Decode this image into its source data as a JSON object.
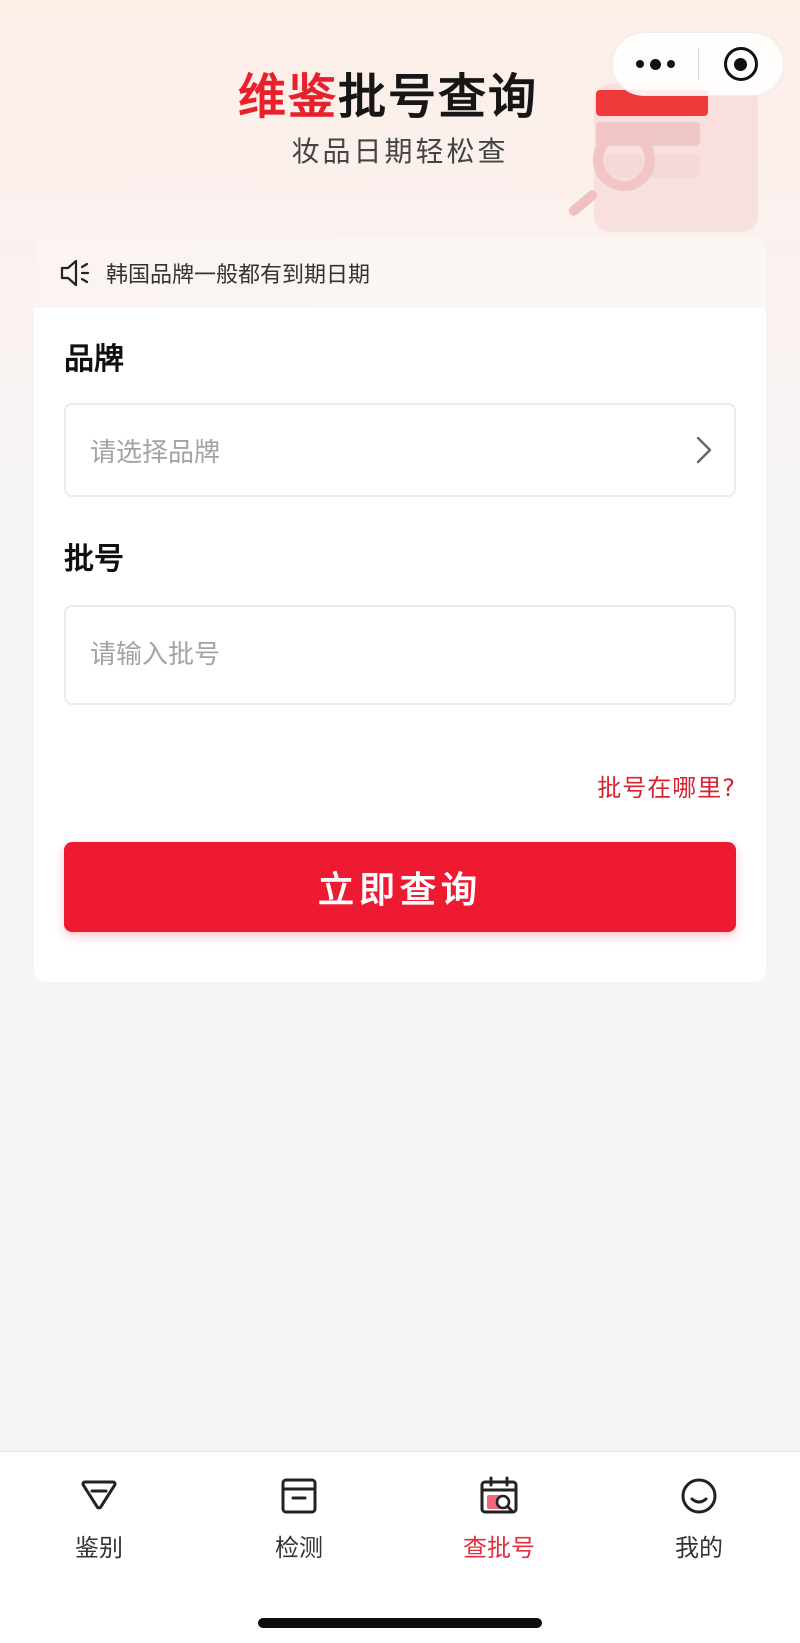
{
  "header": {
    "title_brand": "维鉴",
    "title_main": "批号查询",
    "subtitle": "妆品日期轻松查"
  },
  "capsule": {
    "more_icon": "more-dots-icon",
    "close_icon": "target-circle-icon"
  },
  "notice": {
    "icon": "speaker-icon",
    "text": "韩国品牌一般都有到期日期"
  },
  "form": {
    "brand_label": "品牌",
    "brand_placeholder": "请选择品牌",
    "batch_label": "批号",
    "batch_placeholder": "请输入批号",
    "help_link": "批号在哪里?",
    "submit_label": "立即查询"
  },
  "tabbar": {
    "items": [
      {
        "label": "鉴别",
        "icon": "diamond-icon"
      },
      {
        "label": "检测",
        "icon": "archive-box-icon"
      },
      {
        "label": "查批号",
        "icon": "calendar-search-icon",
        "active": true
      },
      {
        "label": "我的",
        "icon": "smiley-face-icon"
      }
    ]
  },
  "colors": {
    "accent": "#ee1a32",
    "brand_red": "#e8202c",
    "active_tab": "#e0303e"
  }
}
